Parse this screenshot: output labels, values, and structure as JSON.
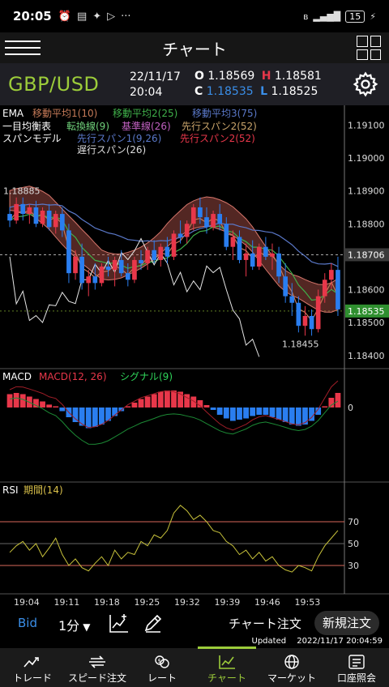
{
  "status": {
    "time": "20:05",
    "icons": [
      "alarm-icon",
      "message-icon",
      "twitter-icon",
      "play-icon",
      "more-icon"
    ],
    "battery": "15"
  },
  "header": {
    "title": "チャート"
  },
  "quote": {
    "pair": "GBP/USD",
    "date": "22/11/17",
    "time": "20:04",
    "o_label": "O",
    "o_value": "1.18569",
    "h_label": "H",
    "h_value": "1.18581",
    "c_label": "C",
    "c_value": "1.18535",
    "l_label": "L",
    "l_value": "1.18525"
  },
  "legend": {
    "ema_title": "EMA",
    "ema1": "移動平均1(10)",
    "ema2": "移動平均2(25)",
    "ema3": "移動平均3(75)",
    "ichimoku_title": "一目均衡表",
    "tenkan": "転換線(9)",
    "kijun": "基準線(26)",
    "senkou2a": "先行スパン2(52)",
    "span_model": "スパンモデル",
    "senkou1": "先行スパン1(9,26)",
    "senkou2b": "先行スパン2(52)",
    "chikou": "遅行スパン(26)",
    "macd_title": "MACD",
    "macd_params": "MACD(12, 26)",
    "signal": "シグナル(9)",
    "rsi_title": "RSI",
    "rsi_params": "期間(14)"
  },
  "chart_data": [
    {
      "type": "candlestick",
      "title": "GBP/USD",
      "timeframe": "1分",
      "x_ticks": [
        "19:04",
        "19:11",
        "19:18",
        "19:25",
        "19:32",
        "19:39",
        "19:46",
        "19:53"
      ],
      "y_ticks": [
        1.191,
        1.19,
        1.189,
        1.188,
        1.187,
        1.186,
        1.185,
        1.184
      ],
      "ylim": [
        1.1836,
        1.1916
      ],
      "current_price_marker": 1.18535,
      "level_marker": 1.18706,
      "annotations": [
        {
          "label": "1.18885",
          "value": 1.18885
        },
        {
          "label": "1.18455",
          "value": 1.18455
        }
      ],
      "candles": [
        [
          1.1883,
          1.1885,
          1.1879,
          1.1881
        ],
        [
          1.1881,
          1.1888,
          1.188,
          1.1886
        ],
        [
          1.1886,
          1.1888,
          1.1881,
          1.1883
        ],
        [
          1.1883,
          1.1886,
          1.188,
          1.1885
        ],
        [
          1.1885,
          1.1887,
          1.1879,
          1.188
        ],
        [
          1.188,
          1.1885,
          1.1879,
          1.1884
        ],
        [
          1.1884,
          1.1886,
          1.1878,
          1.1879
        ],
        [
          1.1879,
          1.1884,
          1.1877,
          1.1883
        ],
        [
          1.1883,
          1.1885,
          1.1876,
          1.1878
        ],
        [
          1.1878,
          1.188,
          1.1862,
          1.1865
        ],
        [
          1.1865,
          1.1872,
          1.1863,
          1.187
        ],
        [
          1.187,
          1.1874,
          1.186,
          1.1862
        ],
        [
          1.1862,
          1.1866,
          1.1858,
          1.1864
        ],
        [
          1.1864,
          1.1868,
          1.186,
          1.1862
        ],
        [
          1.1862,
          1.1868,
          1.1861,
          1.1867
        ],
        [
          1.1867,
          1.187,
          1.1864,
          1.1866
        ],
        [
          1.1866,
          1.187,
          1.1861,
          1.1869
        ],
        [
          1.1869,
          1.1872,
          1.1864,
          1.1865
        ],
        [
          1.1865,
          1.1868,
          1.1861,
          1.1863
        ],
        [
          1.1863,
          1.187,
          1.1862,
          1.1869
        ],
        [
          1.1869,
          1.1872,
          1.1866,
          1.1868
        ],
        [
          1.1868,
          1.1873,
          1.1866,
          1.1872
        ],
        [
          1.1872,
          1.1875,
          1.1868,
          1.1869
        ],
        [
          1.1869,
          1.1874,
          1.1867,
          1.1873
        ],
        [
          1.1873,
          1.1876,
          1.1868,
          1.187
        ],
        [
          1.187,
          1.1878,
          1.1869,
          1.1877
        ],
        [
          1.1877,
          1.1881,
          1.1874,
          1.1876
        ],
        [
          1.1876,
          1.1881,
          1.1874,
          1.188
        ],
        [
          1.188,
          1.1886,
          1.1878,
          1.1885
        ],
        [
          1.1885,
          1.1888,
          1.188,
          1.1882
        ],
        [
          1.1882,
          1.1885,
          1.1877,
          1.1879
        ],
        [
          1.1879,
          1.1884,
          1.1878,
          1.1883
        ],
        [
          1.1883,
          1.1886,
          1.1878,
          1.188
        ],
        [
          1.188,
          1.1882,
          1.1872,
          1.1873
        ],
        [
          1.1873,
          1.1878,
          1.1869,
          1.1876
        ],
        [
          1.1876,
          1.1878,
          1.1868,
          1.1869
        ],
        [
          1.1869,
          1.1874,
          1.1864,
          1.1871
        ],
        [
          1.1871,
          1.1875,
          1.1866,
          1.1867
        ],
        [
          1.1867,
          1.1874,
          1.1866,
          1.1873
        ],
        [
          1.1873,
          1.1876,
          1.1869,
          1.187
        ],
        [
          1.187,
          1.1874,
          1.1866,
          1.1871
        ],
        [
          1.1871,
          1.1873,
          1.1862,
          1.1864
        ],
        [
          1.1864,
          1.1868,
          1.1856,
          1.1858
        ],
        [
          1.1858,
          1.1862,
          1.1852,
          1.1856
        ],
        [
          1.1856,
          1.1858,
          1.1847,
          1.1849
        ],
        [
          1.1849,
          1.1855,
          1.1846,
          1.1852
        ],
        [
          1.1852,
          1.1854,
          1.1846,
          1.1848
        ],
        [
          1.1848,
          1.186,
          1.1847,
          1.1858
        ],
        [
          1.1858,
          1.1865,
          1.1856,
          1.1863
        ],
        [
          1.1863,
          1.1868,
          1.186,
          1.1866
        ],
        [
          1.1866,
          1.187,
          1.1852,
          1.1854
        ]
      ]
    },
    {
      "type": "bar",
      "title": "MACD",
      "series": [
        {
          "name": "MACD(12, 26)",
          "values": [
            0.55,
            0.6,
            0.55,
            0.45,
            0.35,
            0.25,
            0.12,
            0.05,
            -0.15,
            -0.4,
            -0.6,
            -0.75,
            -0.85,
            -0.8,
            -0.7,
            -0.55,
            -0.35,
            -0.15,
            0.05,
            0.2,
            0.35,
            0.45,
            0.55,
            0.65,
            0.7,
            0.7,
            0.65,
            0.55,
            0.45,
            0.3,
            0.1,
            -0.1,
            -0.3,
            -0.45,
            -0.55,
            -0.5,
            -0.45,
            -0.35,
            -0.3,
            -0.3,
            -0.4,
            -0.5,
            -0.6,
            -0.7,
            -0.75,
            -0.7,
            -0.55,
            -0.3,
            0.05,
            0.4,
            0.6
          ]
        }
      ],
      "y_ticks": [
        0
      ]
    },
    {
      "type": "line",
      "title": "RSI",
      "series": [
        {
          "name": "期間(14)",
          "values": [
            42,
            48,
            52,
            44,
            50,
            38,
            46,
            55,
            40,
            30,
            36,
            28,
            25,
            32,
            38,
            30,
            44,
            36,
            42,
            40,
            52,
            48,
            58,
            55,
            62,
            78,
            85,
            80,
            72,
            76,
            70,
            62,
            60,
            52,
            48,
            40,
            44,
            36,
            42,
            34,
            38,
            30,
            26,
            24,
            30,
            28,
            25,
            38,
            48,
            55,
            62
          ]
        }
      ],
      "ylim": [
        0,
        100
      ],
      "y_ticks": [
        70,
        50,
        30
      ]
    }
  ],
  "toolbar": {
    "bid": "Bid",
    "timeframe": "1分",
    "chart_order": "チャート注文",
    "new_order": "新規注文"
  },
  "updated": {
    "label": "Updated",
    "value": "2022/11/17 20:04:59"
  },
  "nav": [
    {
      "label": "トレード",
      "icon": "trade-icon"
    },
    {
      "label": "スピード注文",
      "icon": "speed-order-icon"
    },
    {
      "label": "レート",
      "icon": "rate-icon"
    },
    {
      "label": "チャート",
      "icon": "chart-icon"
    },
    {
      "label": "マーケット",
      "icon": "market-icon"
    },
    {
      "label": "口座照会",
      "icon": "account-icon"
    }
  ],
  "colors": {
    "up": "#e8374a",
    "down": "#2a7ef0",
    "accent": "#9ccc3a",
    "cloud_red": "#b8564e",
    "cloud_blue": "#6f7f9a",
    "ema1": "#c57a58",
    "ema2": "#3fb04a",
    "ema3": "#5a78c8",
    "signal": "#2fd45a",
    "rsi_line": "#c9c33b",
    "rsi_level": "#d9685a"
  }
}
